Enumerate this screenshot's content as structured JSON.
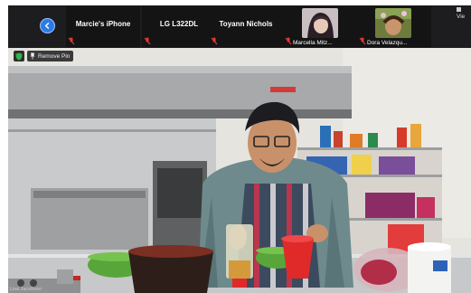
{
  "strip": {
    "participants": [
      {
        "label": "Marcie's iPhone"
      },
      {
        "label": "LG L322DL"
      },
      {
        "label": "Toyann Nichols"
      }
    ],
    "video_thumbs": [
      {
        "label": "Marcella Mitz..."
      },
      {
        "label": "Dora Velazqu..."
      }
    ],
    "view_label": "Vie"
  },
  "video": {
    "remove_pin_label": "Remove Pin",
    "bottom_label": "Lisa Jacobsen",
    "colors": {
      "kitchen_wall": "#e9e7e2",
      "steel": "#8c8e90",
      "bowl_green": "#58a63a",
      "cup_red": "#e02a2a",
      "apron_stripe": "#b9364e"
    }
  }
}
